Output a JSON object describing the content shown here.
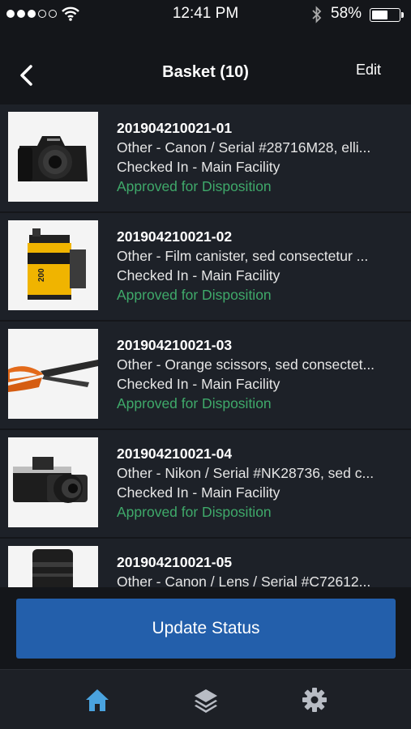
{
  "status_bar": {
    "time": "12:41 PM",
    "battery": "58%",
    "battery_level": 0.58
  },
  "nav": {
    "title": "Basket (10)",
    "edit_label": "Edit"
  },
  "items": [
    {
      "id": "201904210021-01",
      "description": "Other - Canon / Serial #28716M28, elli...",
      "location": "Checked In - Main Facility",
      "status": "Approved for Disposition",
      "thumbnail": "camera-canon"
    },
    {
      "id": "201904210021-02",
      "description": "Other - Film canister, sed consectetur ...",
      "location": "Checked In - Main Facility",
      "status": "Approved for Disposition",
      "thumbnail": "film-canister"
    },
    {
      "id": "201904210021-03",
      "description": "Other - Orange scissors, sed consectet...",
      "location": "Checked In - Main Facility",
      "status": "Approved for Disposition",
      "thumbnail": "scissors"
    },
    {
      "id": "201904210021-04",
      "description": "Other - Nikon / Serial #NK28736, sed c...",
      "location": "Checked In - Main Facility",
      "status": "Approved for Disposition",
      "thumbnail": "camera-nikon"
    },
    {
      "id": "201904210021-05",
      "description": "Other - Canon / Lens / Serial #C72612...",
      "location": "",
      "status": "",
      "thumbnail": "lens"
    }
  ],
  "update_button": {
    "label": "Update Status"
  },
  "tabs": [
    {
      "icon": "home-icon",
      "active": true
    },
    {
      "icon": "layers-icon",
      "active": false
    },
    {
      "icon": "gear-icon",
      "active": false
    }
  ],
  "colors": {
    "accent": "#235fab",
    "status_green": "#3fa96a",
    "tab_active": "#4aa3df",
    "tab_inactive": "#b8bcc4"
  }
}
